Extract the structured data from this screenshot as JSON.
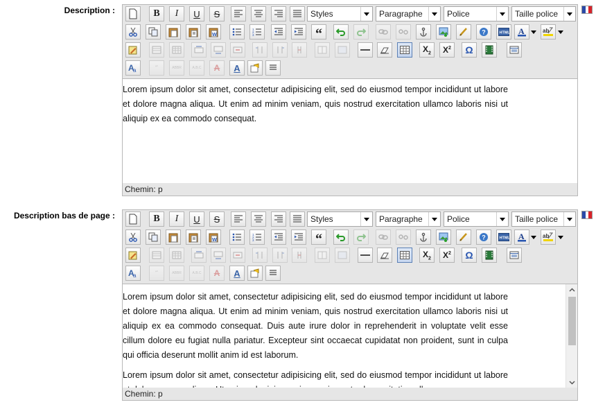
{
  "colors": {
    "flag_blue": "#2b4aa8",
    "flag_white": "#ffffff",
    "flag_red": "#d8232a"
  },
  "fields": [
    {
      "label": "Description :",
      "flag_icon": "french-flag-icon",
      "toolbar": {
        "styles_select": "Styles",
        "format_select": "Paragraphe",
        "font_select": "Police",
        "size_select": "Taille police"
      },
      "paragraphs": [
        "Lorem ipsum dolor sit amet, consectetur adipisicing elit, sed do eiusmod tempor incididunt ut labore et dolore magna aliqua. Ut enim ad minim veniam, quis nostrud exercitation ullamco laboris nisi ut aliquip ex ea commodo consequat."
      ],
      "status": "Chemin: p"
    },
    {
      "label": "Description bas de page :",
      "flag_icon": "french-flag-icon",
      "toolbar": {
        "styles_select": "Styles",
        "format_select": "Paragraphe",
        "font_select": "Police",
        "size_select": "Taille police"
      },
      "paragraphs": [
        "Lorem ipsum dolor sit amet, consectetur adipisicing elit, sed do eiusmod tempor incididunt ut labore et dolore magna aliqua. Ut enim ad minim veniam, quis nostrud exercitation ullamco laboris nisi ut aliquip ex ea commodo consequat. Duis aute irure dolor in reprehenderit in voluptate velit esse cillum dolore eu fugiat nulla pariatur. Excepteur sint occaecat cupidatat non proident, sunt in culpa qui officia deserunt mollit anim id est laborum.",
        "Lorem ipsum dolor sit amet, consectetur adipisicing elit, sed do eiusmod tempor incididunt ut labore et dolore magna aliqua. Ut enim ad minim veniam, quis nostrud exercitation ullamco"
      ],
      "status": "Chemin: p"
    }
  ]
}
